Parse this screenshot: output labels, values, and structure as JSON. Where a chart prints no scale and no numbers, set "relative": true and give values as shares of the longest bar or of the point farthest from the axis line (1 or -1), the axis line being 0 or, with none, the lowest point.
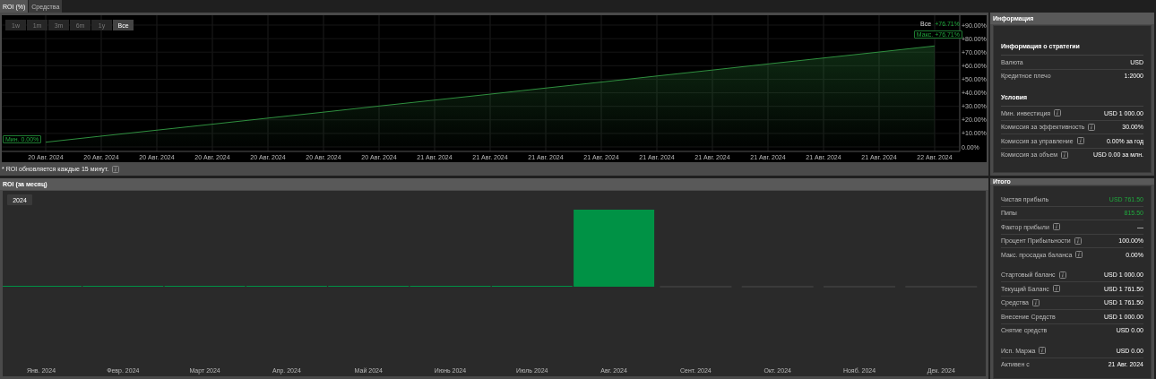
{
  "tabs": [
    {
      "label": "ROI (%)",
      "selected": true
    },
    {
      "label": "Средства",
      "selected": false
    }
  ],
  "roi_panel": {
    "ranges": [
      {
        "label": "1w",
        "selected": false
      },
      {
        "label": "1m",
        "selected": false
      },
      {
        "label": "3m",
        "selected": false
      },
      {
        "label": "6m",
        "selected": false
      },
      {
        "label": "1y",
        "selected": false
      },
      {
        "label": "Все",
        "selected": true
      }
    ],
    "legend": {
      "label": "Все",
      "value": "+76.71%"
    },
    "max_label": "Макс. +76.71%",
    "min_label": "Мин. 0.00%",
    "chart_data": {
      "type": "area",
      "grid": true,
      "ylim": [
        0,
        90
      ],
      "categories": [
        "20 Авг. 2024",
        "20 Авг. 2024",
        "20 Авг. 2024",
        "20 Авг. 2024",
        "20 Авг. 2024",
        "20 Авг. 2024",
        "20 Авг. 2024",
        "21 Авг. 2024",
        "21 Авг. 2024",
        "21 Авг. 2024",
        "21 Авг. 2024",
        "21 Авг. 2024",
        "21 Авг. 2024",
        "21 Авг. 2024",
        "21 Авг. 2024",
        "21 Авг. 2024",
        "22 Авг. 2024"
      ],
      "series": [
        {
          "color": "#2f8f3f",
          "values": [
            3.5,
            8.0,
            12.4,
            16.8,
            21.3,
            25.7,
            30.2,
            34.6,
            39.0,
            43.5,
            47.9,
            52.4,
            56.8,
            61.3,
            65.7,
            70.1,
            74.6
          ]
        }
      ],
      "yticks": [
        {
          "value": 0,
          "label": "0.00%"
        },
        {
          "value": 10,
          "label": "+10.00%"
        },
        {
          "value": 20,
          "label": "+20.00%"
        },
        {
          "value": 30,
          "label": "+30.00%"
        },
        {
          "value": 40,
          "label": "+40.00%"
        },
        {
          "value": 50,
          "label": "+50.00%"
        },
        {
          "value": 60,
          "label": "+60.00%"
        },
        {
          "value": 70,
          "label": "+70.00%"
        },
        {
          "value": 80,
          "label": "+80.00%"
        },
        {
          "value": 90,
          "label": "+90.00%"
        }
      ]
    },
    "footnote": "* ROI обновляется каждые 15 минут."
  },
  "monthly_panel": {
    "title": "ROI (за месяц)",
    "years": [
      {
        "label": "2024",
        "selected": true
      }
    ],
    "chart_data": {
      "type": "bar",
      "relative": true,
      "categories": [
        "Янв. 2024",
        "Февр. 2024",
        "Март 2024",
        "Апр. 2024",
        "Май 2024",
        "Июнь 2024",
        "Июль 2024",
        "Авг. 2024",
        "Сент. 2024",
        "Окт. 2024",
        "Нояб. 2024",
        "Дек. 2024"
      ],
      "series": [
        {
          "color": "#009245",
          "values": [
            0,
            0,
            0,
            0,
            0,
            0,
            0,
            1,
            null,
            null,
            null,
            null
          ]
        }
      ]
    }
  },
  "info_panel": {
    "title": "Информация",
    "sections": [
      {
        "heading": "Информация о стратегии",
        "rows": [
          {
            "label": "Валюта",
            "value": "USD",
            "info": false
          },
          {
            "label": "Кредитное плечо",
            "value": "1:2000",
            "info": false
          }
        ]
      },
      {
        "heading": "Условия",
        "rows": [
          {
            "label": "Мин. инвестиция",
            "value": "USD 1 000.00",
            "info": true
          },
          {
            "label": "Комиссия за эффективность",
            "value": "30.00%",
            "info": true
          },
          {
            "label": "Комиссия за управление",
            "value": "0.00% за год",
            "info": true
          },
          {
            "label": "Комиссия за объем",
            "value": "USD 0.00 за млн.",
            "info": true
          }
        ]
      }
    ]
  },
  "totals_panel": {
    "title": "Итого",
    "groups": [
      {
        "rows": [
          {
            "label": "Чистая прибыль",
            "value": "USD 761.50",
            "info": false,
            "positive": true
          },
          {
            "label": "Пипы",
            "value": "815.50",
            "info": false,
            "positive": true
          },
          {
            "label": "Фактор прибыли",
            "value": "—",
            "info": true,
            "positive": false
          },
          {
            "label": "Процент Прибыльности",
            "value": "100.00%",
            "info": true,
            "positive": false
          },
          {
            "label": "Макс. просадка баланса",
            "value": "0.00%",
            "info": true,
            "positive": false
          }
        ]
      },
      {
        "rows": [
          {
            "label": "Стартовый баланс",
            "value": "USD 1 000.00",
            "info": true,
            "positive": false
          },
          {
            "label": "Текущий Баланс",
            "value": "USD 1 761.50",
            "info": true,
            "positive": false
          },
          {
            "label": "Средства",
            "value": "USD 1 761.50",
            "info": true,
            "positive": false
          },
          {
            "label": "Внесение Средств",
            "value": "USD 1 000.00",
            "info": false,
            "positive": false
          },
          {
            "label": "Снятие средств",
            "value": "USD 0.00",
            "info": false,
            "positive": false
          }
        ]
      },
      {
        "rows": [
          {
            "label": "Исп. Маржа",
            "value": "USD 0.00",
            "info": true,
            "positive": false
          },
          {
            "label": "Активен с",
            "value": "21 Авг. 2024",
            "info": false,
            "positive": false
          }
        ]
      }
    ]
  }
}
